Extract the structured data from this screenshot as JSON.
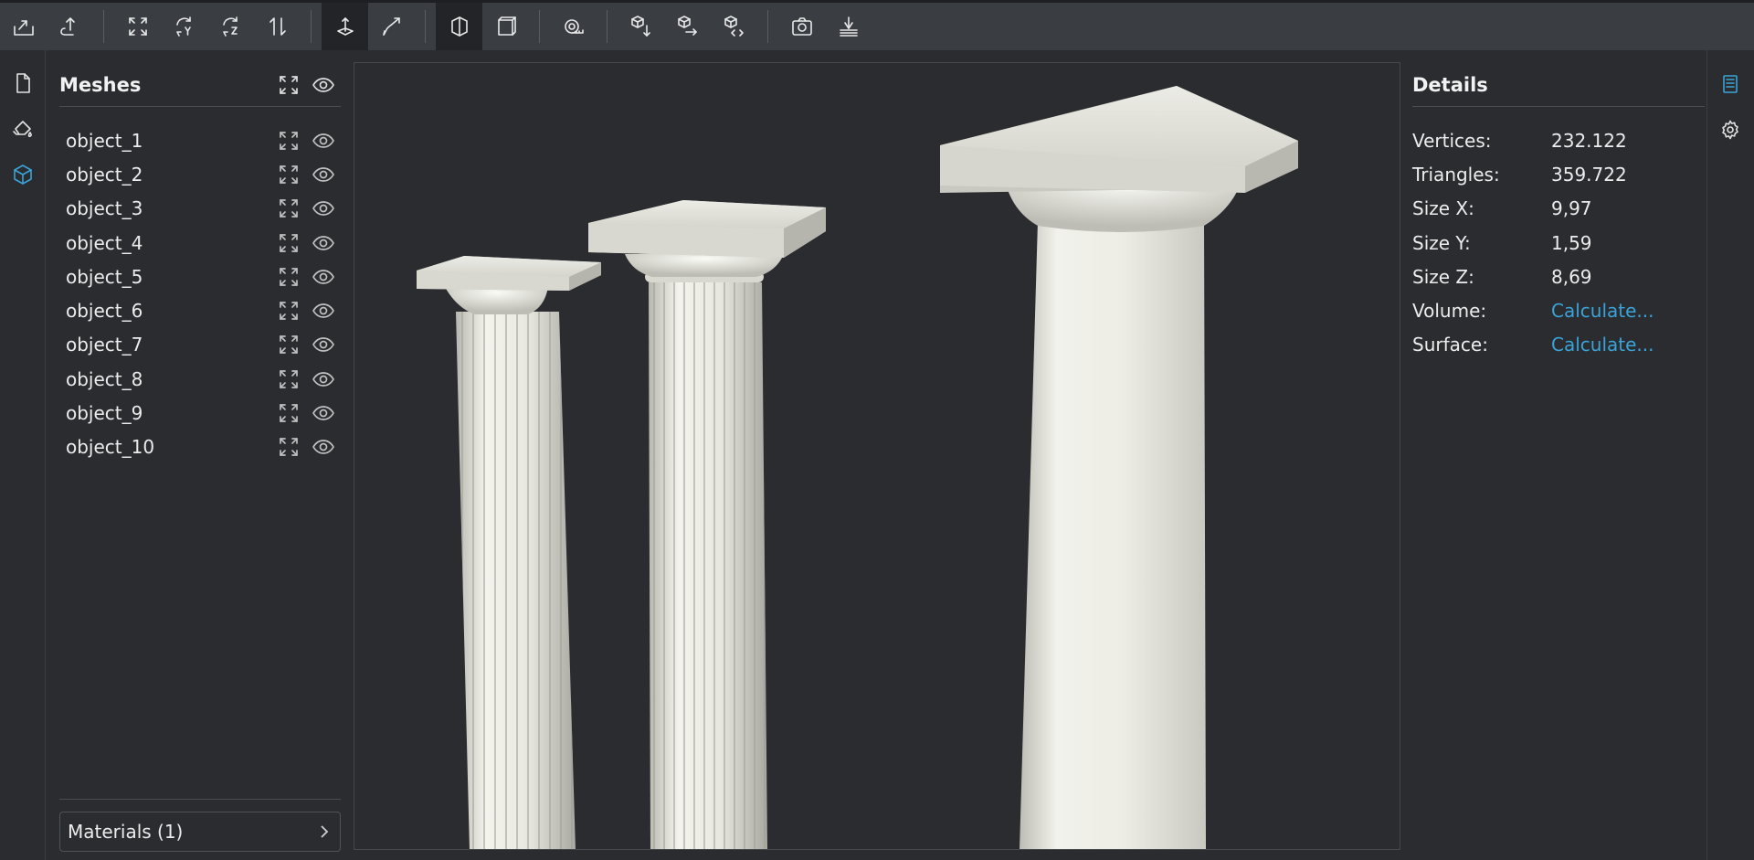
{
  "toolbar": {
    "buttons": [
      {
        "icon": "import-icon"
      },
      {
        "icon": "export-icon"
      },
      {
        "icon": "fit-view-icon"
      },
      {
        "icon": "rotate-y-icon"
      },
      {
        "icon": "rotate-z-icon"
      },
      {
        "icon": "flip-axis-icon"
      },
      {
        "icon": "place-on-ground-icon"
      },
      {
        "icon": "curve-tool-icon"
      },
      {
        "icon": "shaded-view-icon"
      },
      {
        "icon": "wireframe-box-icon"
      },
      {
        "icon": "measure-tape-icon"
      },
      {
        "icon": "cube-down-icon"
      },
      {
        "icon": "cube-right-icon"
      },
      {
        "icon": "cube-code-icon"
      },
      {
        "icon": "camera-icon"
      },
      {
        "icon": "ground-plane-icon"
      }
    ]
  },
  "meshes": {
    "title": "Meshes",
    "items": [
      {
        "name": "object_1"
      },
      {
        "name": "object_2"
      },
      {
        "name": "object_3"
      },
      {
        "name": "object_4"
      },
      {
        "name": "object_5"
      },
      {
        "name": "object_6"
      },
      {
        "name": "object_7"
      },
      {
        "name": "object_8"
      },
      {
        "name": "object_9"
      },
      {
        "name": "object_10"
      }
    ],
    "materials_label": "Materials (1)"
  },
  "details": {
    "title": "Details",
    "rows": [
      {
        "label": "Vertices:",
        "value": "232.122"
      },
      {
        "label": "Triangles:",
        "value": "359.722"
      },
      {
        "label": "Size X:",
        "value": "9,97"
      },
      {
        "label": "Size Y:",
        "value": "1,59"
      },
      {
        "label": "Size Z:",
        "value": "8,69"
      },
      {
        "label": "Volume:",
        "value": "Calculate..."
      },
      {
        "label": "Surface:",
        "value": "Calculate..."
      }
    ]
  },
  "colors": {
    "accent": "#3aa3d8",
    "background": "#2a2c30",
    "toolbar": "#3a3d42",
    "column": "#e4e4dc"
  }
}
